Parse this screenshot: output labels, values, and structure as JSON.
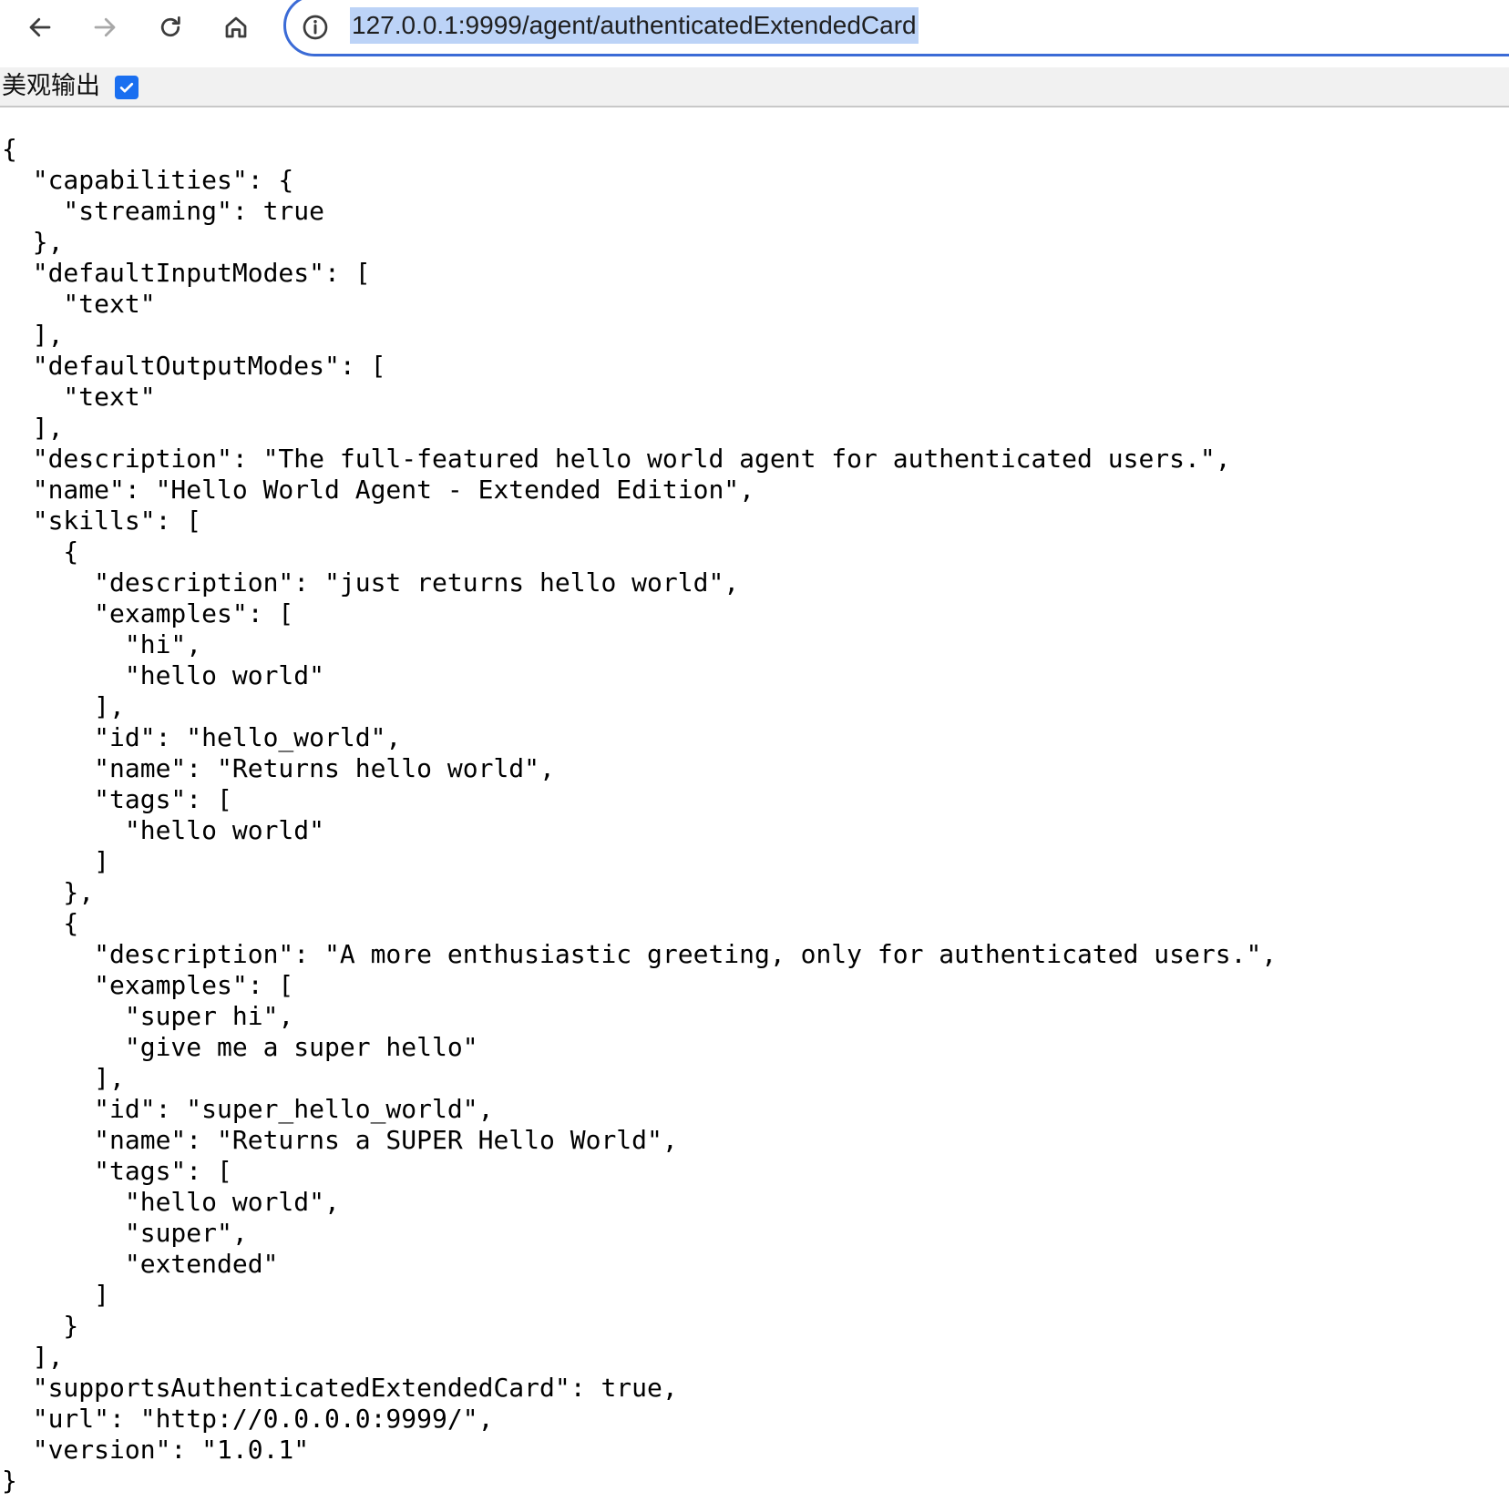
{
  "browser": {
    "back_icon": "arrow-left-icon",
    "forward_icon": "arrow-right-icon",
    "reload_icon": "reload-icon",
    "home_icon": "home-icon",
    "site_info_icon": "info-icon",
    "url": "127.0.0.1:9999/agent/authenticatedExtendedCard"
  },
  "toolbar": {
    "pretty_print_label": "美观输出",
    "pretty_print_checked": true
  },
  "json_lines": [
    "{",
    "  \"capabilities\": {",
    "    \"streaming\": true",
    "  },",
    "  \"defaultInputModes\": [",
    "    \"text\"",
    "  ],",
    "  \"defaultOutputModes\": [",
    "    \"text\"",
    "  ],",
    "  \"description\": \"The full-featured hello world agent for authenticated users.\",",
    "  \"name\": \"Hello World Agent - Extended Edition\",",
    "  \"skills\": [",
    "    {",
    "      \"description\": \"just returns hello world\",",
    "      \"examples\": [",
    "        \"hi\",",
    "        \"hello world\"",
    "      ],",
    "      \"id\": \"hello_world\",",
    "      \"name\": \"Returns hello world\",",
    "      \"tags\": [",
    "        \"hello world\"",
    "      ]",
    "    },",
    "    {",
    "      \"description\": \"A more enthusiastic greeting, only for authenticated users.\",",
    "      \"examples\": [",
    "        \"super hi\",",
    "        \"give me a super hello\"",
    "      ],",
    "      \"id\": \"super_hello_world\",",
    "      \"name\": \"Returns a SUPER Hello World\",",
    "      \"tags\": [",
    "        \"hello world\",",
    "        \"super\",",
    "        \"extended\"",
    "      ]",
    "    }",
    "  ],",
    "  \"supportsAuthenticatedExtendedCard\": true,",
    "  \"url\": \"http://0.0.0.0:9999/\",",
    "  \"version\": \"1.0.1\"",
    "}"
  ]
}
